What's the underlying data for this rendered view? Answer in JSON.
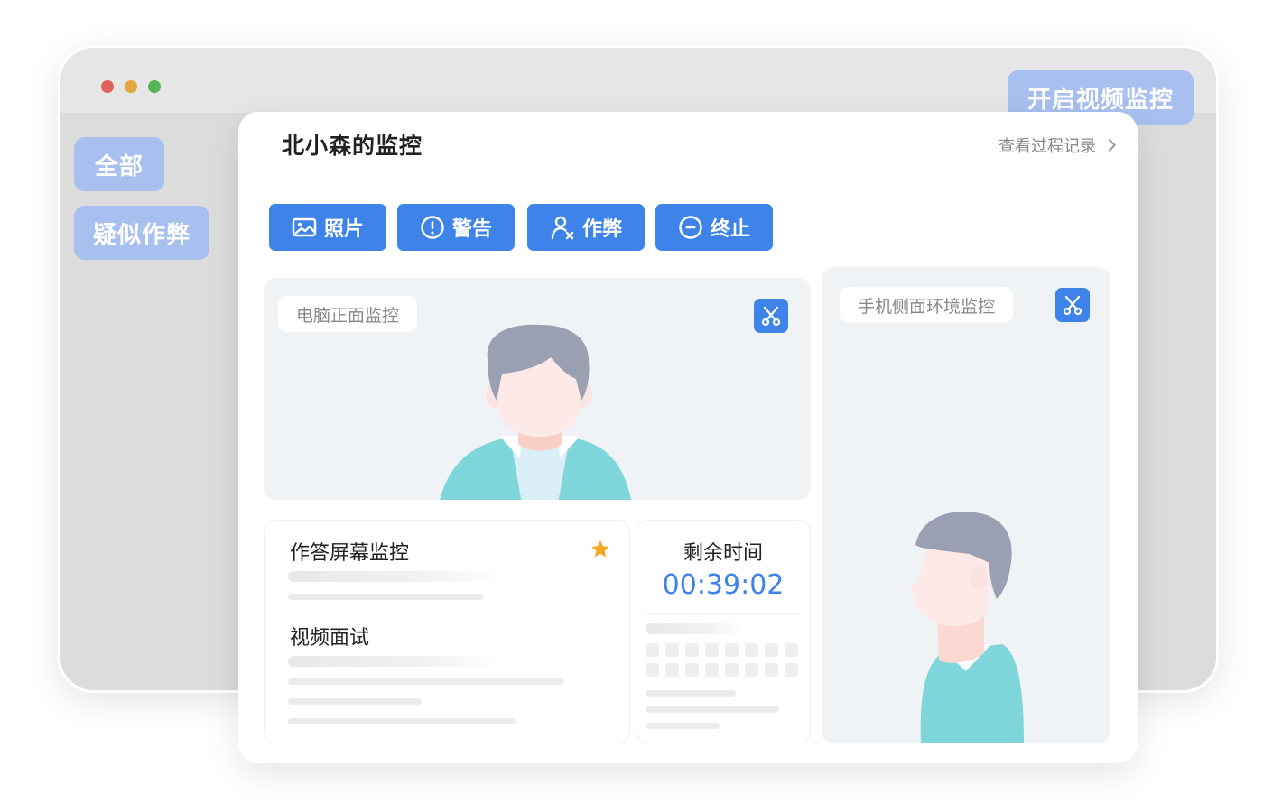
{
  "background": {
    "filters": [
      {
        "label": "全部"
      },
      {
        "label": "疑似作弊"
      }
    ],
    "video_button": "开启视频监控"
  },
  "card": {
    "title": "北小森的监控",
    "history_link": "查看过程记录",
    "actions": [
      {
        "label": "照片",
        "icon": "image-icon"
      },
      {
        "label": "警告",
        "icon": "exclamation-circle-icon"
      },
      {
        "label": "作弊",
        "icon": "user-x-icon"
      },
      {
        "label": "终止",
        "icon": "minus-circle-icon"
      }
    ],
    "front_panel": {
      "label": "电脑正面监控",
      "icon": "scissors-icon"
    },
    "side_panel": {
      "label": "手机侧面环境监控",
      "icon": "scissors-icon"
    },
    "screen_panel": {
      "title": "作答屏幕监控",
      "star_icon": "star-icon",
      "section2_title": "视频面试"
    },
    "timer_panel": {
      "label": "剩余时间",
      "value": "00:39:02"
    }
  },
  "colors": {
    "accent": "#3d83ea",
    "pill": "#a7c0ef",
    "star": "#f5a623",
    "shirt": "#7fd6da",
    "hair": "#9aa0b2"
  }
}
